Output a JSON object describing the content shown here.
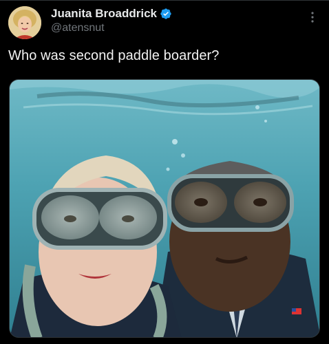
{
  "author": {
    "display_name": "Juanita Broaddrick",
    "handle": "@atensnut",
    "verified": true,
    "avatar_icon": "avatar"
  },
  "tweet": {
    "text": "Who was second paddle boarder?"
  },
  "media": {
    "type": "image",
    "icon": "photo-underwater-divers"
  },
  "colors": {
    "background": "#000000",
    "text": "#e7e9ea",
    "muted": "#71767b",
    "verified": "#1d9bf0",
    "water": "#4ea3b3"
  }
}
